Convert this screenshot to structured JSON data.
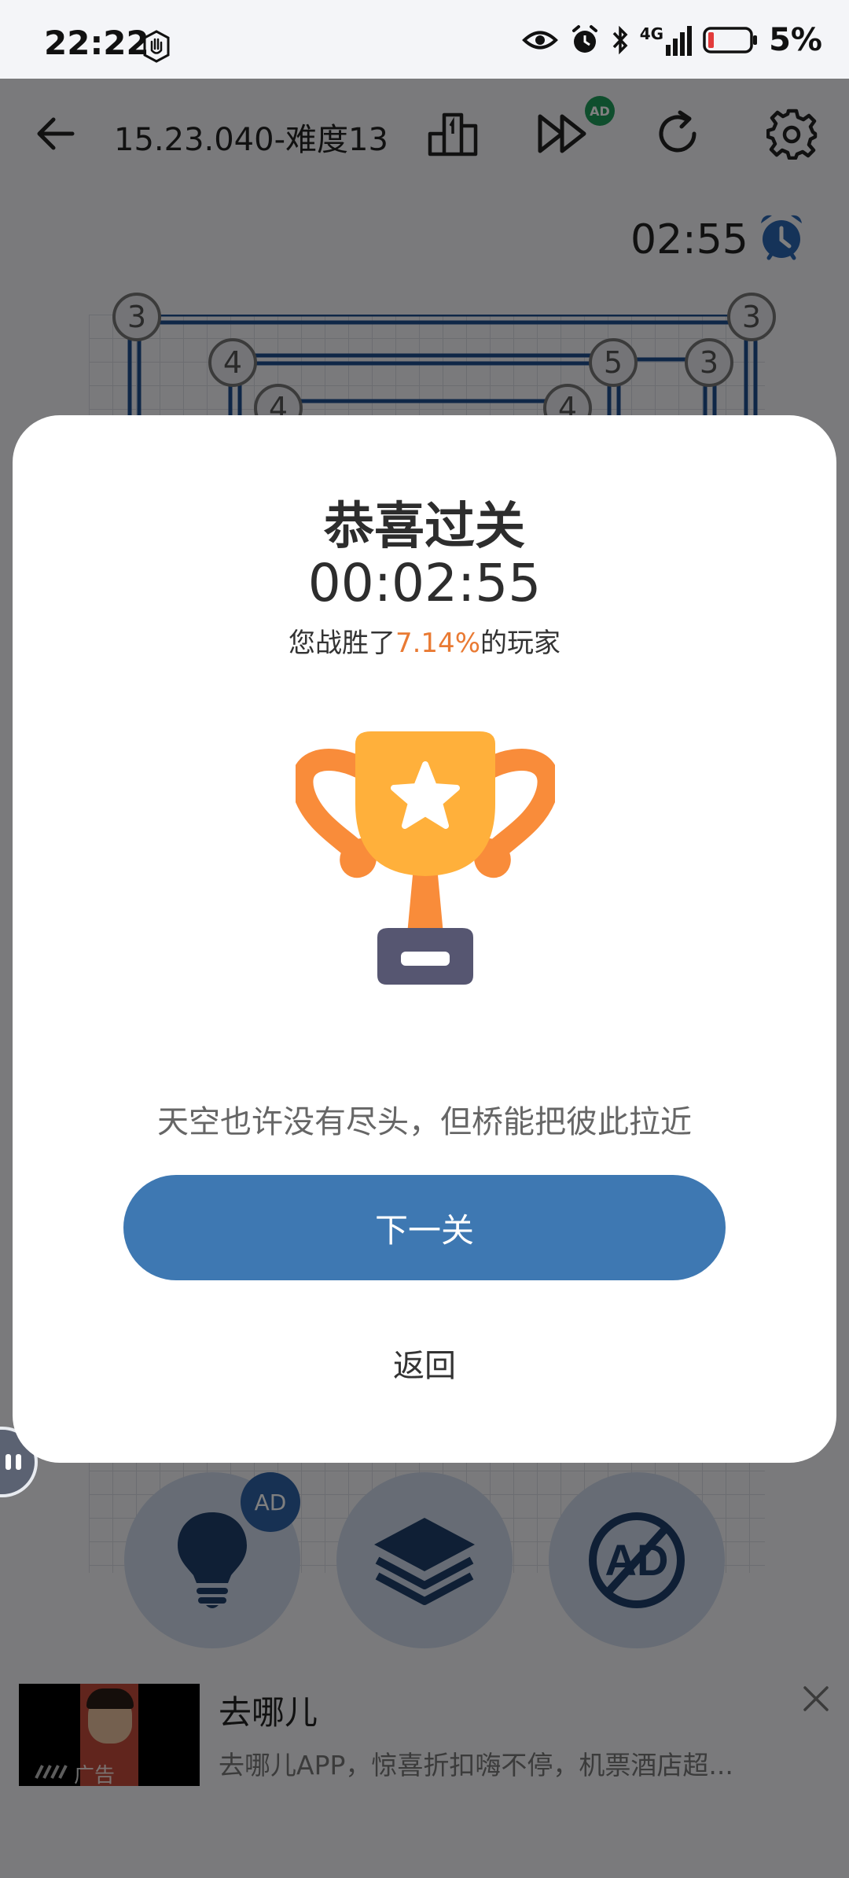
{
  "status": {
    "time": "22:22",
    "network": "4G",
    "battery": "5%"
  },
  "header": {
    "level": "15.23.040-难度13",
    "skip_ad_badge": "AD"
  },
  "game": {
    "timer": "02:55",
    "islands": [
      "3",
      "3",
      "4",
      "5",
      "3",
      "4",
      "4"
    ]
  },
  "dialog": {
    "title": "恭喜过关",
    "time": "00:02:55",
    "rank_prefix": "您战胜了",
    "rank_pct": "7.14%",
    "rank_suffix": "的玩家",
    "quote": "天空也许没有尽头，但桥能把彼此拉近",
    "next_label": "下一关",
    "back_label": "返回"
  },
  "toolbar": {
    "hint_ad_badge": "AD",
    "remove_ad_text": "AD"
  },
  "ad": {
    "name": "去哪儿",
    "description": "去哪儿APP，惊喜折扣嗨不停，机票酒店超...",
    "label": "广告"
  },
  "colors": {
    "accent": "#3e78b2",
    "highlight": "#e97a33",
    "trophy_cup": "#ffb03b",
    "trophy_handles": "#f98c3a",
    "trophy_base": "#565671",
    "bridge": "#1e4f8f"
  }
}
